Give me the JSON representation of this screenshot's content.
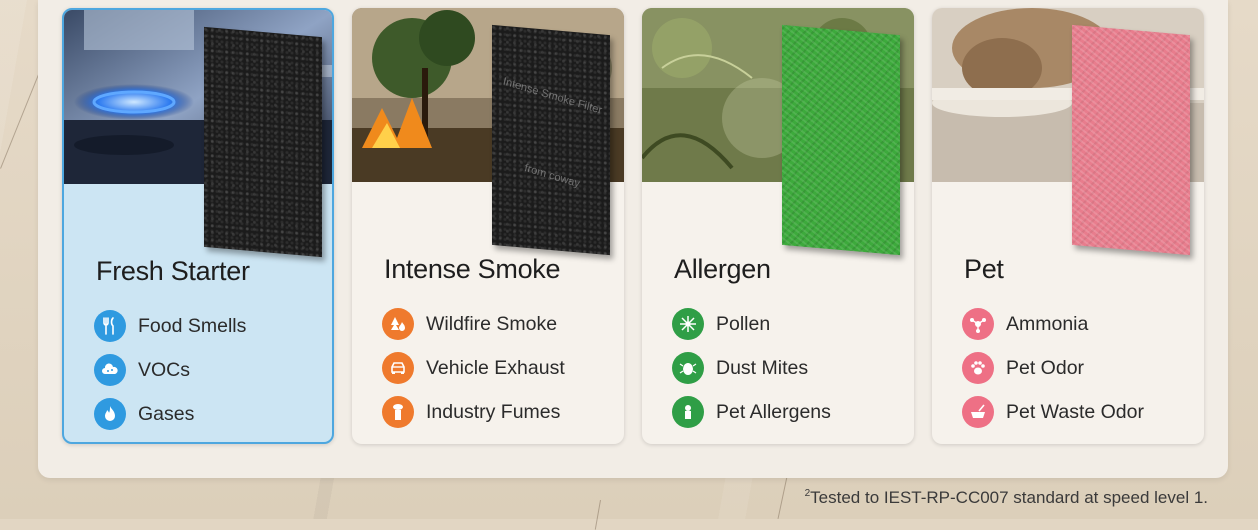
{
  "cards": [
    {
      "title": "Fresh Starter",
      "filter_color": "#1b1b1b",
      "photo": "gas-stove",
      "accent": "#2f9ae0",
      "selected": true,
      "features": [
        {
          "label": "Food Smells",
          "icon": "utensils-icon"
        },
        {
          "label": "VOCs",
          "icon": "cloud-icon"
        },
        {
          "label": "Gases",
          "icon": "flame-icon"
        }
      ]
    },
    {
      "title": "Intense Smoke",
      "filter_color": "#1b1b1b",
      "filter_label": "Intense Smoke Filter",
      "filter_brand": "from coway",
      "photo": "wildfire",
      "accent": "#ef7a2d",
      "features": [
        {
          "label": "Wildfire Smoke",
          "icon": "fire-tree-icon"
        },
        {
          "label": "Vehicle Exhaust",
          "icon": "car-icon"
        },
        {
          "label": "Industry Fumes",
          "icon": "factory-icon"
        }
      ]
    },
    {
      "title": "Allergen",
      "filter_color": "#3daa3c",
      "photo": "pollen-plants",
      "accent": "#2f9e46",
      "features": [
        {
          "label": "Pollen",
          "icon": "pollen-icon"
        },
        {
          "label": "Dust Mites",
          "icon": "dust-mite-icon"
        },
        {
          "label": "Pet Allergens",
          "icon": "pet-allergen-icon"
        }
      ]
    },
    {
      "title": "Pet",
      "filter_color": "#e87d8d",
      "photo": "cat-litter",
      "accent": "#ee7085",
      "features": [
        {
          "label": "Ammonia",
          "icon": "molecule-icon"
        },
        {
          "label": "Pet Odor",
          "icon": "paw-icon"
        },
        {
          "label": "Pet Waste Odor",
          "icon": "litter-box-icon"
        }
      ]
    }
  ],
  "footnote": {
    "marker": "2",
    "text": "Tested to IEST-RP-CC007 standard at speed level 1."
  }
}
